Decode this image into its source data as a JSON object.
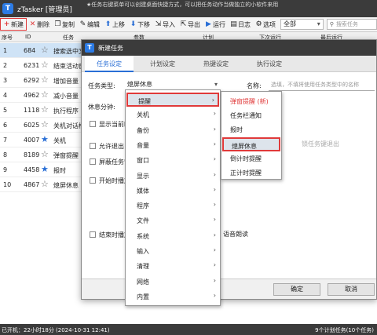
{
  "app": {
    "title": "zTasker [管理员]",
    "marquee": "★任务右键菜单可以创建桌面快捷方式，可以把任务动作当做独立的小软件来用"
  },
  "toolbar": {
    "new": "新建",
    "delete": "删除",
    "copy": "复制",
    "edit": "编辑",
    "up": "上移",
    "down": "下移",
    "import": "导入",
    "export": "导出",
    "run": "运行",
    "log": "日志",
    "options": "选项",
    "filter": "全部",
    "search_placeholder": "搜索任务"
  },
  "table": {
    "headers": {
      "seq": "序号",
      "id": "ID",
      "task": "任务",
      "params": "参数",
      "plan": "计划",
      "next": "下次运行",
      "last": "最后运行"
    },
    "rows": [
      {
        "seq": "1",
        "id": "684",
        "name": "搜索选中文",
        "star": "outline",
        "selected": true
      },
      {
        "seq": "2",
        "id": "6231",
        "name": "结束活动窗",
        "star": "outline"
      },
      {
        "seq": "3",
        "id": "6292",
        "name": "增加音量",
        "star": "outline"
      },
      {
        "seq": "4",
        "id": "4962",
        "name": "减小音量",
        "star": "outline"
      },
      {
        "seq": "5",
        "id": "1118",
        "name": "执行程序",
        "star": "outline"
      },
      {
        "seq": "6",
        "id": "6025",
        "name": "关机对话框",
        "star": "outline"
      },
      {
        "seq": "7",
        "id": "4007",
        "name": "关机",
        "star": "blue"
      },
      {
        "seq": "8",
        "id": "8189",
        "name": "弹窗提醒",
        "star": "outline"
      },
      {
        "seq": "9",
        "id": "4458",
        "name": "报时",
        "star": "blue"
      },
      {
        "seq": "10",
        "id": "4867",
        "name": "熄屏休息",
        "star": "outline"
      }
    ]
  },
  "status": {
    "left": "已开机：22小时18分 (2024-10-31 12:41)",
    "right": "9个计划任务(10个任务)"
  },
  "dialog": {
    "title": "新建任务",
    "tabs": [
      "任务设定",
      "计划设定",
      "热键设定",
      "执行设定"
    ],
    "task_type_label": "任务类型:",
    "task_type_value": "熄屏休息",
    "name_label": "名称:",
    "name_placeholder": "选填，不填将使用任务类型中的名称",
    "rest_label": "休息分钟:",
    "show_time_label": "显示当前时",
    "allow_exit_label": "允许退出",
    "block_task_label": "屏蔽任务管",
    "start_play_label": "开始时播放",
    "end_play_label": "结束时播放",
    "hotkey_exit_text": "锁任务键退出",
    "voice_read_text": "语音朗读",
    "ok": "确定",
    "cancel": "取消"
  },
  "menu1": {
    "items": [
      "提醒",
      "关机",
      "备份",
      "音量",
      "窗口",
      "显示",
      "媒体",
      "程序",
      "文件",
      "系统",
      "输入",
      "清理",
      "网络",
      "内置"
    ]
  },
  "menu2": {
    "items": [
      "弹窗提醒 (新)",
      "任务栏通知",
      "报时",
      "熄屏休息",
      "倒计时提醒",
      "正计时提醒"
    ]
  },
  "colors": {
    "accent": "#2a6fd6",
    "highlight_border": "#e03a3a",
    "titlebar": "#3b3b3b"
  }
}
